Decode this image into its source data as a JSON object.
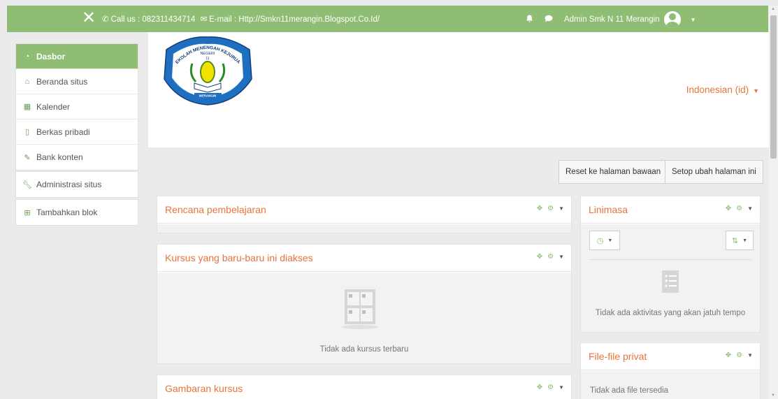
{
  "topbar": {
    "close_glyph": "✕",
    "phone_icon": "phone-icon",
    "call_text": "Call us : 082311434714",
    "email_icon": "envelope-icon",
    "email_text": "E-mail : Http://Smkn11merangin.Blogspot.Co.Id/",
    "user_name": "Admin Smk N 11 Merangin"
  },
  "sidebar": {
    "items": [
      {
        "label": "Dasbor",
        "icon": "dashboard-icon"
      },
      {
        "label": "Beranda situs",
        "icon": "home-icon"
      },
      {
        "label": "Kalender",
        "icon": "calendar-icon"
      },
      {
        "label": "Berkas pribadi",
        "icon": "file-icon"
      },
      {
        "label": "Bank konten",
        "icon": "pencil-icon"
      }
    ],
    "admin": {
      "label": "Administrasi situs",
      "icon": "wrench-icon"
    },
    "add_block": {
      "label": "Tambahkan blok",
      "icon": "plus-square-icon"
    }
  },
  "header": {
    "language": "Indonesian (id)",
    "logo": {
      "top_text": "SEKOLAH MENENGAH KEJURUAN",
      "negeri": "NEGERI",
      "number": "11",
      "bottom_text": "MERANGIN"
    }
  },
  "page_buttons": {
    "reset": "Reset ke halaman bawaan",
    "customize": "Setop ubah halaman ini"
  },
  "blocks": {
    "learning_plans": {
      "title": "Rencana pembelajaran"
    },
    "recent_courses": {
      "title": "Kursus yang baru-baru ini diakses",
      "empty": "Tidak ada kursus terbaru"
    },
    "course_overview": {
      "title": "Gambaran kursus"
    },
    "timeline": {
      "title": "Linimasa",
      "empty": "Tidak ada aktivitas yang akan jatuh tempo"
    },
    "private_files": {
      "title": "File-file privat",
      "empty": "Tidak ada file tersedia"
    }
  },
  "colors": {
    "brand_green": "#8fbd74",
    "accent_orange": "#e8743b"
  }
}
